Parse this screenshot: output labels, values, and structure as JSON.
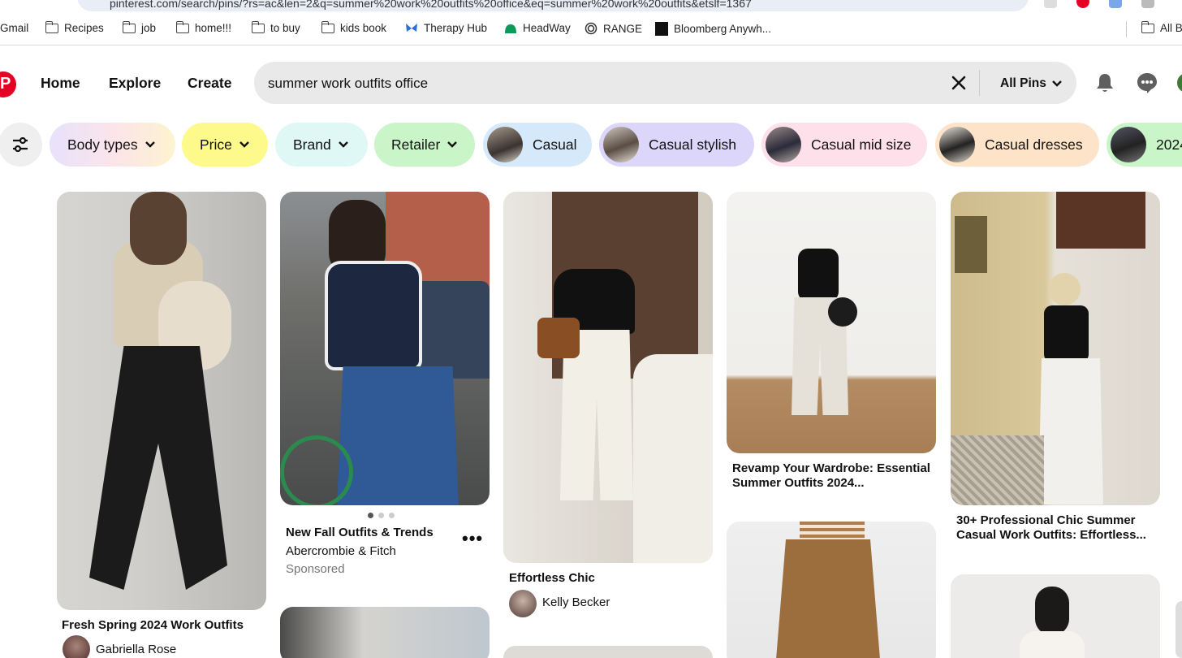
{
  "browser": {
    "url": "pinterest.com/search/pins/?rs=ac&len=2&q=summer%20work%20outfits%20office&eq=summer%20work%20outfits&etslf=1367",
    "bookmarks": [
      "Gmail",
      "Recipes",
      "job",
      "home!!!",
      "to buy",
      "kids book",
      "Therapy Hub",
      "HeadWay",
      "RANGE",
      "Bloomberg Anywh...",
      "All B"
    ]
  },
  "header": {
    "nav": [
      "Home",
      "Explore",
      "Create"
    ],
    "search_query": "summer work outfits office",
    "scope": "All Pins"
  },
  "filters": [
    {
      "label": "Body types",
      "dropdown": true,
      "color": "#f3e3e8"
    },
    {
      "label": "Price",
      "dropdown": true,
      "color": "#fdf98a"
    },
    {
      "label": "Brand",
      "dropdown": true,
      "color": "#dff8f5"
    },
    {
      "label": "Retailer",
      "dropdown": true,
      "color": "#c9f5c9"
    },
    {
      "label": "Casual",
      "dropdown": false,
      "color": "#d6e9fb"
    },
    {
      "label": "Casual stylish",
      "dropdown": false,
      "color": "#dcd6fb"
    },
    {
      "label": "Casual mid size",
      "dropdown": false,
      "color": "#fde0ea"
    },
    {
      "label": "Casual dresses",
      "dropdown": false,
      "color": "#fde3c8"
    },
    {
      "label": "2024",
      "dropdown": false,
      "color": "#c9f5c9"
    }
  ],
  "pins": [
    {
      "title": "Fresh Spring 2024 Work Outfits",
      "author": "Gabriella Rose"
    },
    {
      "title": "New Fall Outfits & Trends",
      "author": "Abercrombie & Fitch",
      "sponsored_label": "Sponsored"
    },
    {
      "title": "Effortless Chic",
      "author": "Kelly Becker"
    },
    {
      "title": "Revamp Your Wardrobe: Essential Summer Outfits 2024..."
    },
    {
      "title": "30+ Professional Chic Summer Casual Work Outfits: Effortless..."
    }
  ],
  "colors": {
    "brand": "#e60023",
    "search_bg": "#e9e9e9"
  }
}
